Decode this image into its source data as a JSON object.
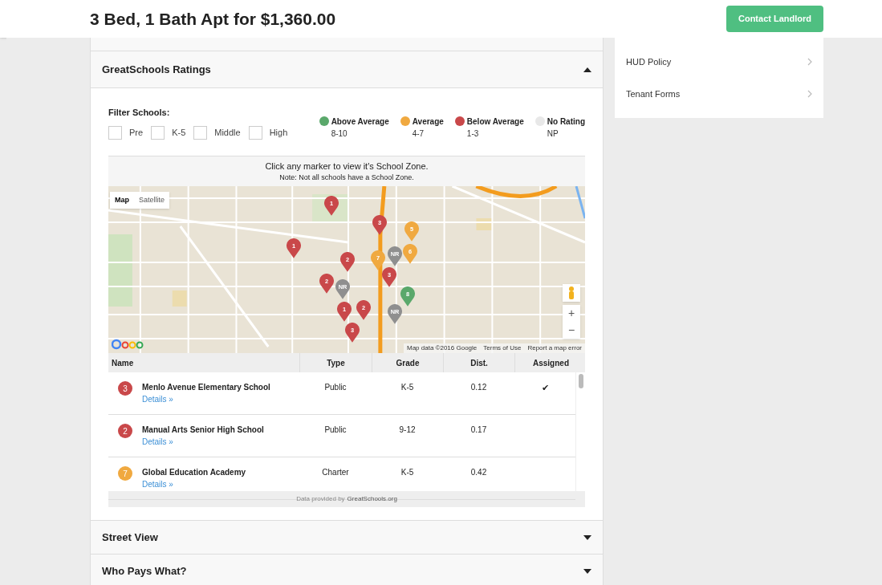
{
  "header": {
    "title": "3 Bed, 1 Bath Apt for $1,360.00",
    "contact_button": "Contact Landlord"
  },
  "sidebar": {
    "items": [
      {
        "label": "HUD Policy"
      },
      {
        "label": "Tenant Forms"
      }
    ]
  },
  "schools_section": {
    "title": "GreatSchools Ratings",
    "expanded": true,
    "filter_label": "Filter Schools:",
    "filters": [
      {
        "label": "Pre",
        "checked": false
      },
      {
        "label": "K-5",
        "checked": false
      },
      {
        "label": "Middle",
        "checked": false
      },
      {
        "label": "High",
        "checked": false
      }
    ],
    "legend": [
      {
        "label": "Above Average",
        "range": "8-10",
        "color": "#5aa86b"
      },
      {
        "label": "Average",
        "range": "4-7",
        "color": "#f0a940"
      },
      {
        "label": "Below Average",
        "range": "1-3",
        "color": "#c9484a"
      },
      {
        "label": "No Rating",
        "range": "NP",
        "color": "#e8e8e8"
      }
    ],
    "map_note": "Click any marker to view it's School Zone.",
    "map_subnote": "Note: Not all schools have a School Zone.",
    "map": {
      "kind": "picture",
      "map_types": [
        {
          "label": "Map",
          "selected": true
        },
        {
          "label": "Satellite",
          "selected": false
        }
      ],
      "zoom_in": "+",
      "zoom_out": "−",
      "attribution": "Map data ©2016 Google",
      "terms": "Terms of Use",
      "report": "Report a map error",
      "markers": [
        {
          "label": "1",
          "color": "#c9484a"
        },
        {
          "label": "3",
          "color": "#c9484a"
        },
        {
          "label": "5",
          "color": "#f0a940"
        },
        {
          "label": "1",
          "color": "#c9484a"
        },
        {
          "label": "6",
          "color": "#f0a940"
        },
        {
          "label": "NR",
          "color": "#8f8f8f"
        },
        {
          "label": "2",
          "color": "#c9484a"
        },
        {
          "label": "7",
          "color": "#f0a940"
        },
        {
          "label": "3",
          "color": "#c9484a"
        },
        {
          "label": "2",
          "color": "#c9484a"
        },
        {
          "label": "NR",
          "color": "#8f8f8f"
        },
        {
          "label": "8",
          "color": "#5aa86b"
        },
        {
          "label": "1",
          "color": "#c9484a"
        },
        {
          "label": "2",
          "color": "#c9484a"
        },
        {
          "label": "NR",
          "color": "#8f8f8f"
        },
        {
          "label": "3",
          "color": "#c9484a"
        }
      ]
    },
    "table": {
      "columns": [
        "Name",
        "Type",
        "Grade",
        "Dist.",
        "Assigned"
      ],
      "rows": [
        {
          "rating": "3",
          "color": "#c9484a",
          "name": "Menlo Avenue Elementary School",
          "link": "Details »",
          "type": "Public",
          "grade": "K-5",
          "dist": "0.12",
          "assigned": true
        },
        {
          "rating": "2",
          "color": "#c9484a",
          "name": "Manual Arts Senior High School",
          "link": "Details »",
          "type": "Public",
          "grade": "9-12",
          "dist": "0.17",
          "assigned": false
        },
        {
          "rating": "7",
          "color": "#f0a940",
          "name": "Global Education Academy",
          "link": "Details »",
          "type": "Charter",
          "grade": "K-5",
          "dist": "0.42",
          "assigned": false
        }
      ],
      "assigned_mark": "✔",
      "footer_prefix": "Data provided by",
      "footer_link": "GreatSchools.org"
    }
  },
  "sections": [
    {
      "title": "Street View",
      "expanded": false
    },
    {
      "title": "Who Pays What?",
      "expanded": false
    }
  ]
}
